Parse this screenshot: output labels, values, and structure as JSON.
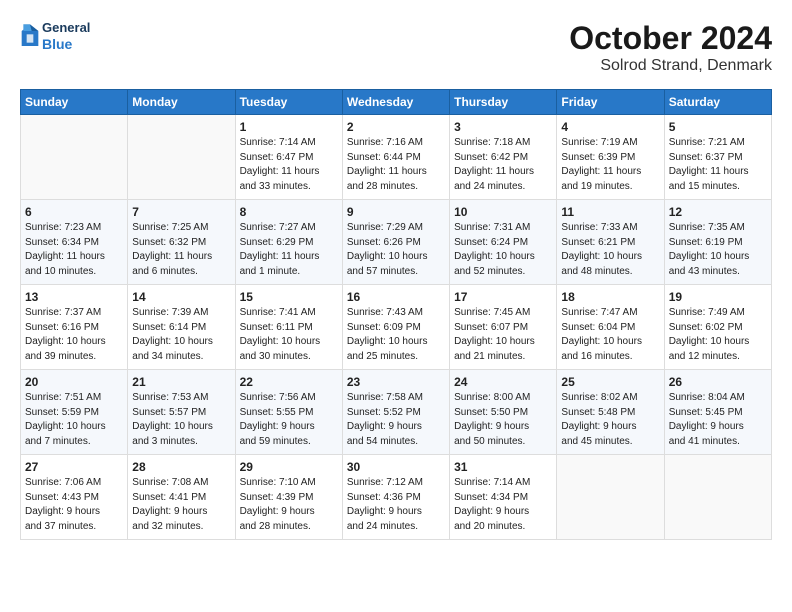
{
  "header": {
    "logo_general": "General",
    "logo_blue": "Blue",
    "title": "October 2024",
    "subtitle": "Solrod Strand, Denmark"
  },
  "days_of_week": [
    "Sunday",
    "Monday",
    "Tuesday",
    "Wednesday",
    "Thursday",
    "Friday",
    "Saturday"
  ],
  "weeks": [
    [
      {
        "day": "",
        "info": ""
      },
      {
        "day": "",
        "info": ""
      },
      {
        "day": "1",
        "info": "Sunrise: 7:14 AM\nSunset: 6:47 PM\nDaylight: 11 hours\nand 33 minutes."
      },
      {
        "day": "2",
        "info": "Sunrise: 7:16 AM\nSunset: 6:44 PM\nDaylight: 11 hours\nand 28 minutes."
      },
      {
        "day": "3",
        "info": "Sunrise: 7:18 AM\nSunset: 6:42 PM\nDaylight: 11 hours\nand 24 minutes."
      },
      {
        "day": "4",
        "info": "Sunrise: 7:19 AM\nSunset: 6:39 PM\nDaylight: 11 hours\nand 19 minutes."
      },
      {
        "day": "5",
        "info": "Sunrise: 7:21 AM\nSunset: 6:37 PM\nDaylight: 11 hours\nand 15 minutes."
      }
    ],
    [
      {
        "day": "6",
        "info": "Sunrise: 7:23 AM\nSunset: 6:34 PM\nDaylight: 11 hours\nand 10 minutes."
      },
      {
        "day": "7",
        "info": "Sunrise: 7:25 AM\nSunset: 6:32 PM\nDaylight: 11 hours\nand 6 minutes."
      },
      {
        "day": "8",
        "info": "Sunrise: 7:27 AM\nSunset: 6:29 PM\nDaylight: 11 hours\nand 1 minute."
      },
      {
        "day": "9",
        "info": "Sunrise: 7:29 AM\nSunset: 6:26 PM\nDaylight: 10 hours\nand 57 minutes."
      },
      {
        "day": "10",
        "info": "Sunrise: 7:31 AM\nSunset: 6:24 PM\nDaylight: 10 hours\nand 52 minutes."
      },
      {
        "day": "11",
        "info": "Sunrise: 7:33 AM\nSunset: 6:21 PM\nDaylight: 10 hours\nand 48 minutes."
      },
      {
        "day": "12",
        "info": "Sunrise: 7:35 AM\nSunset: 6:19 PM\nDaylight: 10 hours\nand 43 minutes."
      }
    ],
    [
      {
        "day": "13",
        "info": "Sunrise: 7:37 AM\nSunset: 6:16 PM\nDaylight: 10 hours\nand 39 minutes."
      },
      {
        "day": "14",
        "info": "Sunrise: 7:39 AM\nSunset: 6:14 PM\nDaylight: 10 hours\nand 34 minutes."
      },
      {
        "day": "15",
        "info": "Sunrise: 7:41 AM\nSunset: 6:11 PM\nDaylight: 10 hours\nand 30 minutes."
      },
      {
        "day": "16",
        "info": "Sunrise: 7:43 AM\nSunset: 6:09 PM\nDaylight: 10 hours\nand 25 minutes."
      },
      {
        "day": "17",
        "info": "Sunrise: 7:45 AM\nSunset: 6:07 PM\nDaylight: 10 hours\nand 21 minutes."
      },
      {
        "day": "18",
        "info": "Sunrise: 7:47 AM\nSunset: 6:04 PM\nDaylight: 10 hours\nand 16 minutes."
      },
      {
        "day": "19",
        "info": "Sunrise: 7:49 AM\nSunset: 6:02 PM\nDaylight: 10 hours\nand 12 minutes."
      }
    ],
    [
      {
        "day": "20",
        "info": "Sunrise: 7:51 AM\nSunset: 5:59 PM\nDaylight: 10 hours\nand 7 minutes."
      },
      {
        "day": "21",
        "info": "Sunrise: 7:53 AM\nSunset: 5:57 PM\nDaylight: 10 hours\nand 3 minutes."
      },
      {
        "day": "22",
        "info": "Sunrise: 7:56 AM\nSunset: 5:55 PM\nDaylight: 9 hours\nand 59 minutes."
      },
      {
        "day": "23",
        "info": "Sunrise: 7:58 AM\nSunset: 5:52 PM\nDaylight: 9 hours\nand 54 minutes."
      },
      {
        "day": "24",
        "info": "Sunrise: 8:00 AM\nSunset: 5:50 PM\nDaylight: 9 hours\nand 50 minutes."
      },
      {
        "day": "25",
        "info": "Sunrise: 8:02 AM\nSunset: 5:48 PM\nDaylight: 9 hours\nand 45 minutes."
      },
      {
        "day": "26",
        "info": "Sunrise: 8:04 AM\nSunset: 5:45 PM\nDaylight: 9 hours\nand 41 minutes."
      }
    ],
    [
      {
        "day": "27",
        "info": "Sunrise: 7:06 AM\nSunset: 4:43 PM\nDaylight: 9 hours\nand 37 minutes."
      },
      {
        "day": "28",
        "info": "Sunrise: 7:08 AM\nSunset: 4:41 PM\nDaylight: 9 hours\nand 32 minutes."
      },
      {
        "day": "29",
        "info": "Sunrise: 7:10 AM\nSunset: 4:39 PM\nDaylight: 9 hours\nand 28 minutes."
      },
      {
        "day": "30",
        "info": "Sunrise: 7:12 AM\nSunset: 4:36 PM\nDaylight: 9 hours\nand 24 minutes."
      },
      {
        "day": "31",
        "info": "Sunrise: 7:14 AM\nSunset: 4:34 PM\nDaylight: 9 hours\nand 20 minutes."
      },
      {
        "day": "",
        "info": ""
      },
      {
        "day": "",
        "info": ""
      }
    ]
  ]
}
